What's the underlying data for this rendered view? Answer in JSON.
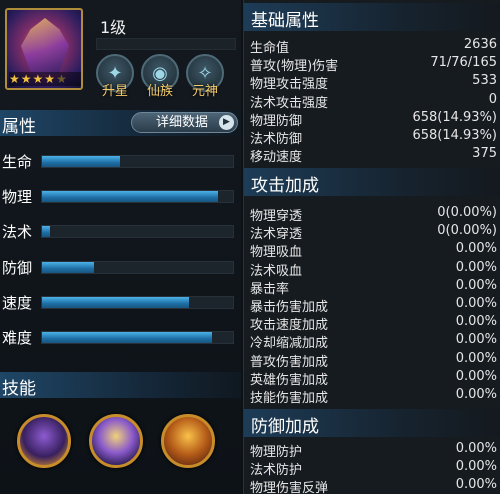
{
  "hero": {
    "level": "1级",
    "stars_filled": 4,
    "stars_total": 5,
    "buttons": [
      {
        "label": "升星",
        "icon": "star-upgrade-icon"
      },
      {
        "label": "仙族",
        "icon": "clan-icon"
      },
      {
        "label": "元神",
        "icon": "spirit-icon"
      }
    ]
  },
  "attributes": {
    "title": "属性",
    "detail_button": "详细数据",
    "stats": [
      {
        "label": "生命",
        "value": 0.41
      },
      {
        "label": "物理",
        "value": 0.92
      },
      {
        "label": "法术",
        "value": 0.04
      },
      {
        "label": "防御",
        "value": 0.27
      },
      {
        "label": "速度",
        "value": 0.77
      },
      {
        "label": "难度",
        "value": 0.89
      }
    ]
  },
  "skills": {
    "title": "技能",
    "items": [
      "skill-1-icon",
      "skill-2-icon",
      "skill-3-icon"
    ]
  },
  "base": {
    "title": "基础属性",
    "rows": [
      {
        "k": "生命值",
        "v": "2636"
      },
      {
        "k": "普攻(物理)伤害",
        "v": "71/76/165"
      },
      {
        "k": "物理攻击强度",
        "v": "533"
      },
      {
        "k": "法术攻击强度",
        "v": "0"
      },
      {
        "k": "物理防御",
        "v": "658(14.93%)"
      },
      {
        "k": "法术防御",
        "v": "658(14.93%)"
      },
      {
        "k": "移动速度",
        "v": "375"
      }
    ]
  },
  "attack": {
    "title": "攻击加成",
    "rows": [
      {
        "k": "物理穿透",
        "v": "0(0.00%)"
      },
      {
        "k": "法术穿透",
        "v": "0(0.00%)"
      },
      {
        "k": "物理吸血",
        "v": "0.00%"
      },
      {
        "k": "法术吸血",
        "v": "0.00%"
      },
      {
        "k": "暴击率",
        "v": "0.00%"
      },
      {
        "k": "暴击伤害加成",
        "v": "0.00%"
      },
      {
        "k": "攻击速度加成",
        "v": "0.00%"
      },
      {
        "k": "冷却缩减加成",
        "v": "0.00%"
      },
      {
        "k": "普攻伤害加成",
        "v": "0.00%"
      },
      {
        "k": "英雄伤害加成",
        "v": "0.00%"
      },
      {
        "k": "技能伤害加成",
        "v": "0.00%"
      }
    ]
  },
  "defense": {
    "title": "防御加成",
    "rows": [
      {
        "k": "物理防护",
        "v": "0.00%"
      },
      {
        "k": "法术防护",
        "v": "0.00%"
      },
      {
        "k": "物理伤害反弹",
        "v": "0.00%"
      }
    ]
  }
}
